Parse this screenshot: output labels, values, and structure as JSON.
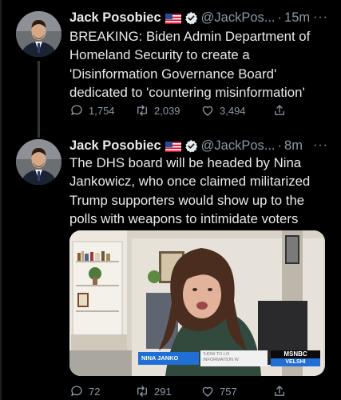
{
  "colors": {
    "background": "#000000",
    "text": "#e7e9ea",
    "secondary_text": "#8b98a5",
    "verified": "#1d9bf0",
    "msnbc_blue": "#1f6fd6"
  },
  "tweets": [
    {
      "author_name": "Jack Posobiec",
      "flag_icon": "us-flag-icon",
      "verified_icon": "verified-badge-icon",
      "handle": "@JackPos...",
      "separator": "·",
      "time": "15m",
      "more_icon": "more-icon",
      "more_label": "···",
      "text": "BREAKING: Biden Admin Department of\nHomeland Security to create a\n'Disinformation Governance Board'\ndedicated to 'countering misinformation'",
      "replies": "1,754",
      "retweets": "2,039",
      "likes": "3,494",
      "reply_icon": "reply-icon",
      "retweet_icon": "retweet-icon",
      "like_icon": "heart-icon",
      "share_icon": "share-icon"
    },
    {
      "author_name": "Jack Posobiec",
      "flag_icon": "us-flag-icon",
      "verified_icon": "verified-badge-icon",
      "handle": "@JackPos...",
      "separator": "·",
      "time": "8m",
      "more_icon": "more-icon",
      "more_label": "···",
      "text": "The DHS board will be headed by Nina\nJankowicz, who once claimed militarized\nTrump supporters would show up to the\npolls with weapons to intimidate voters",
      "replies": "72",
      "retweets": "291",
      "likes": "757",
      "reply_icon": "reply-icon",
      "retweet_icon": "retweet-icon",
      "like_icon": "heart-icon",
      "share_icon": "share-icon",
      "media": {
        "lower_third_name": "NINA JANKO",
        "lower_third_topic": "\"HOW TO LO\nINFORMATION W",
        "brand": "MSNBC",
        "show": "VELSHI"
      }
    }
  ]
}
